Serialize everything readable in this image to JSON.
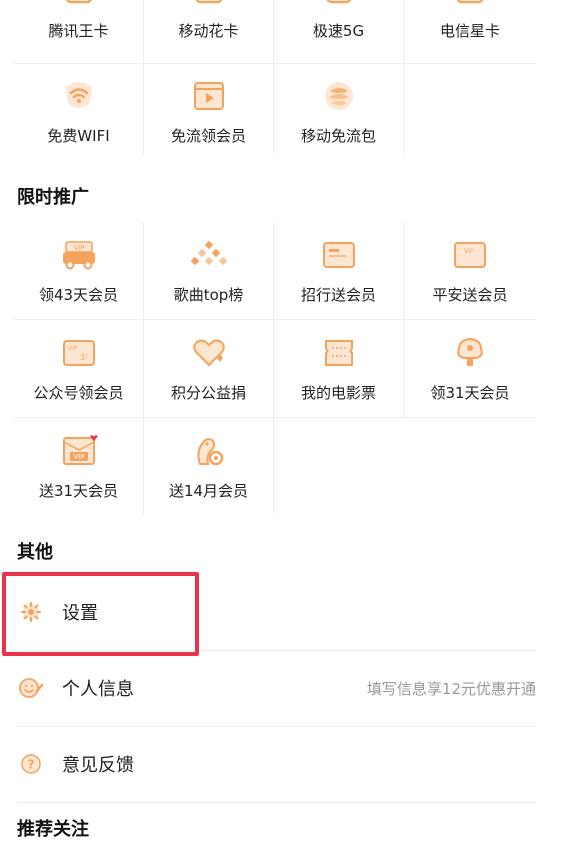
{
  "top_row": [
    {
      "label": "腾讯王卡",
      "icon": "phone-card-icon"
    },
    {
      "label": "移动花卡",
      "icon": "phone-card-icon"
    },
    {
      "label": "极速5G",
      "icon": "phone-card-icon"
    },
    {
      "label": "电信星卡",
      "icon": "phone-card-icon"
    }
  ],
  "data_free": [
    {
      "label": "免费WIFI",
      "icon": "wifi-icon"
    },
    {
      "label": "免流领会员",
      "icon": "video-play-icon"
    },
    {
      "label": "移动免流包",
      "icon": "china-mobile-icon"
    }
  ],
  "promo": {
    "title": "限时推广",
    "items": [
      {
        "label": "领43天会员",
        "icon": "vip-car-icon"
      },
      {
        "label": "歌曲top榜",
        "icon": "chart-dots-icon"
      },
      {
        "label": "招行送会员",
        "icon": "bank-card-icon"
      },
      {
        "label": "平安送会员",
        "icon": "vip-card-icon"
      },
      {
        "label": "公众号领会员",
        "icon": "vip-ticket-icon"
      },
      {
        "label": "积分公益捐",
        "icon": "heart-charity-icon"
      },
      {
        "label": "我的电影票",
        "icon": "movie-ticket-icon"
      },
      {
        "label": "领31天会员",
        "icon": "gift-tree-icon"
      },
      {
        "label": "送31天会员",
        "icon": "vip-envelope-icon"
      },
      {
        "label": "送14月会员",
        "icon": "mascot-icon"
      }
    ]
  },
  "other": {
    "title": "其他",
    "items": [
      {
        "label": "设置",
        "icon": "gear-icon",
        "hint": ""
      },
      {
        "label": "个人信息",
        "icon": "smile-face-icon",
        "hint": "填写信息享12元优惠开通"
      },
      {
        "label": "意见反馈",
        "icon": "question-icon",
        "hint": ""
      }
    ]
  },
  "next_section_title": "推荐关注",
  "colors": {
    "accent": "#f5a35c",
    "highlight": "#e8334d",
    "divider": "#eeeeee"
  }
}
